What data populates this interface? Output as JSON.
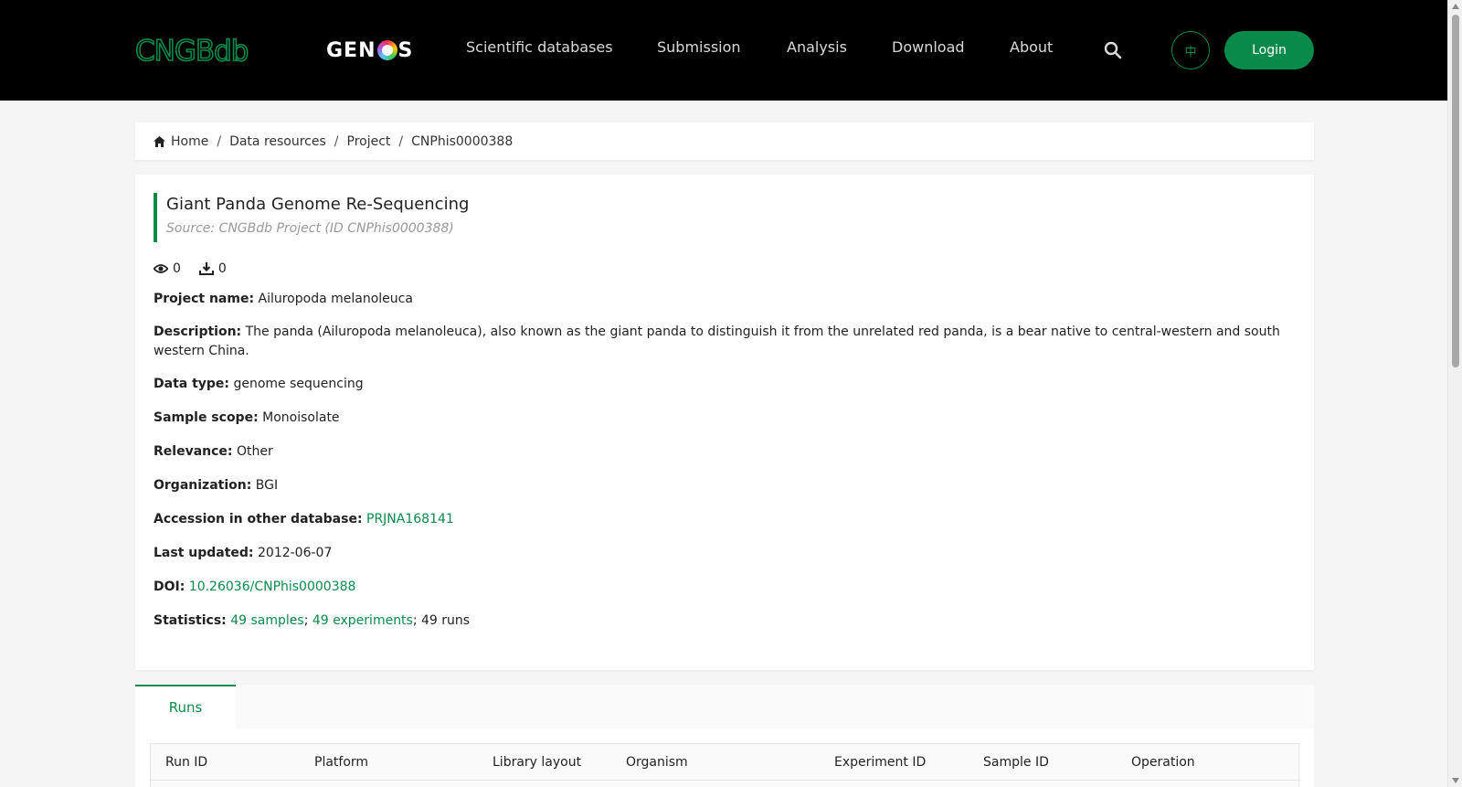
{
  "header": {
    "logo_text": "CNGBdb",
    "genos_logo_text": "GENOS",
    "nav": [
      {
        "label": "Scientific databases"
      },
      {
        "label": "Submission"
      },
      {
        "label": "Analysis"
      },
      {
        "label": "Download"
      },
      {
        "label": "About"
      }
    ],
    "search_icon": "search-icon",
    "lang_label": "中",
    "login_label": "Login",
    "accent_color": "#0a8a4a"
  },
  "breadcrumb": {
    "items": [
      "Home",
      "Data resources",
      "Project",
      "CNPhis0000388"
    ]
  },
  "record": {
    "title": "Giant Panda Genome Re-Sequencing",
    "source": "Source: CNGBdb Project (ID CNPhis0000388)",
    "views": "0",
    "downloads": "0",
    "fields": {
      "project_name_label": "Project name:",
      "project_name": "Ailuropoda melanoleuca",
      "description_label": "Description:",
      "description": "The panda (Ailuropoda melanoleuca), also known as the giant panda to distinguish it from the unrelated red panda, is a bear native to central-western and south western China.",
      "data_type_label": "Data type:",
      "data_type": "genome sequencing",
      "sample_scope_label": "Sample scope:",
      "sample_scope": "Monoisolate",
      "relevance_label": "Relevance:",
      "relevance": "Other",
      "organization_label": "Organization:",
      "organization": "BGI",
      "accession_label": "Accession in other database:",
      "accession": "PRJNA168141",
      "last_updated_label": "Last updated:",
      "last_updated": "2012-06-07",
      "doi_label": "DOI:",
      "doi": "10.26036/CNPhis0000388",
      "statistics_label": "Statistics:",
      "stat_samples": "49 samples",
      "stat_sep1": ";",
      "stat_experiments": "49 experiments",
      "stat_runs": "; 49 runs"
    }
  },
  "tabs": [
    {
      "label": "Runs"
    }
  ],
  "runs_table": {
    "columns": [
      "Run ID",
      "Platform",
      "Library layout",
      "Organism",
      "Experiment ID",
      "Sample ID",
      "Operation"
    ]
  }
}
